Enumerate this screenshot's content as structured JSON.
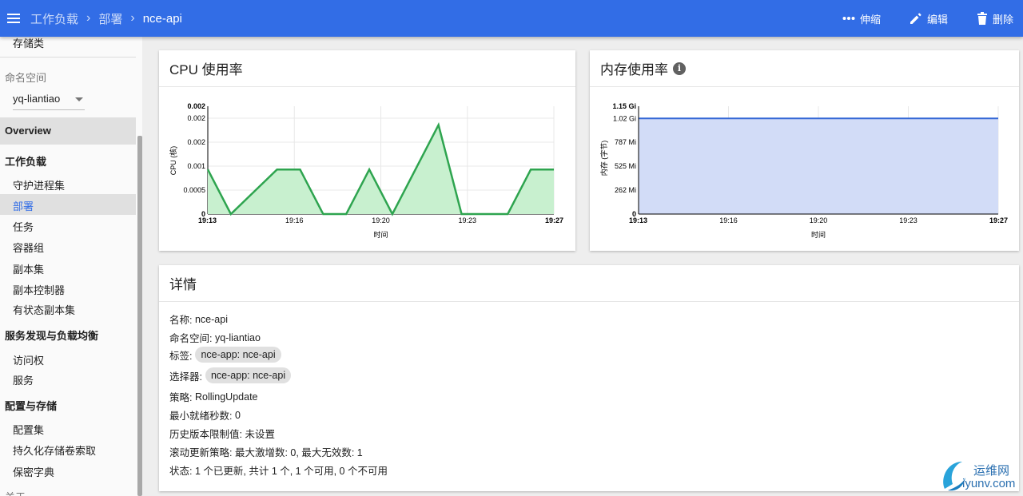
{
  "topbar": {
    "menu_icon": "menu-icon",
    "breadcrumb": {
      "workloads": "工作负载",
      "deployments": "部署",
      "current": "nce-api"
    },
    "actions": {
      "scale": "伸缩",
      "edit": "编辑",
      "delete": "删除"
    }
  },
  "sidebar": {
    "storage_class": "存储类",
    "namespace_label": "命名空间",
    "namespace_value": "yq-liantiao",
    "overview": "Overview",
    "workloads_header": "工作负载",
    "workloads": [
      "守护进程集",
      "部署",
      "任务",
      "容器组",
      "副本集",
      "副本控制器",
      "有状态副本集"
    ],
    "discovery_header": "服务发现与负载均衡",
    "discovery": [
      "访问权",
      "服务"
    ],
    "config_header": "配置与存储",
    "config": [
      "配置集",
      "持久化存储卷索取",
      "保密字典"
    ],
    "about_partial": "关于"
  },
  "cpu_card": {
    "title": "CPU 使用率"
  },
  "mem_card": {
    "title": "内存使用率",
    "info_icon": "info-icon"
  },
  "chart_data": [
    {
      "type": "area",
      "title": "CPU 使用率",
      "xlabel": "时间",
      "ylabel": "CPU (核)",
      "x_ticks": [
        "19:13",
        "19:16",
        "19:20",
        "19:23",
        "19:27"
      ],
      "y_ticks": [
        "0",
        "0.0005",
        "0.001",
        "0.002",
        "0.002",
        "0.002"
      ],
      "ylim": [
        0,
        0.0022
      ],
      "x": [
        "19:13",
        "19:14",
        "19:15",
        "19:16",
        "19:16:30",
        "19:17",
        "19:18",
        "19:19",
        "19:20",
        "19:21",
        "19:22",
        "19:23",
        "19:24",
        "19:25",
        "19:26",
        "19:27"
      ],
      "values": [
        0.001,
        0.0,
        0.0005,
        0.001,
        0.001,
        0.0,
        0.0,
        0.001,
        0.0,
        0.001,
        0.002,
        0.0,
        0.0,
        0.0,
        0.001,
        0.001
      ],
      "color": "#2ea44f",
      "fill": "#c8f0cf"
    },
    {
      "type": "area",
      "title": "内存使用率",
      "xlabel": "时间",
      "ylabel": "内存 (字节)",
      "x_ticks": [
        "19:13",
        "19:16",
        "19:20",
        "19:23",
        "19:27"
      ],
      "y_ticks": [
        "0",
        "262 Mi",
        "525 Mi",
        "787 Mi",
        "1.02 Gi",
        "1.15 Gi"
      ],
      "ylim": [
        0,
        1.15
      ],
      "values": [
        1.02,
        1.02,
        1.02,
        1.02,
        1.02
      ],
      "unit": "Gi",
      "color": "#3367d6",
      "fill": "#d2dcf7"
    }
  ],
  "details": {
    "title": "详情",
    "name_label": "名称:",
    "name_value": "nce-api",
    "namespace_label": "命名空间:",
    "namespace_value": "yq-liantiao",
    "labels_label": "标签:",
    "labels_value": "nce-app: nce-api",
    "selector_label": "选择器:",
    "selector_value": "nce-app: nce-api",
    "strategy_label": "策略:",
    "strategy_value": "RollingUpdate",
    "min_ready_label": "最小就绪秒数:",
    "min_ready_value": "0",
    "history_label": "历史版本限制值:",
    "history_value": "未设置",
    "rolling_label": "滚动更新策略:",
    "rolling_value": "最大激增数: 0, 最大无效数: 1",
    "status_label": "状态:",
    "status_value": "1 个已更新, 共计 1 个, 1 个可用, 0 个不可用"
  },
  "watermark": {
    "text_cn": "运维网",
    "text_en": "iyunv.com"
  }
}
